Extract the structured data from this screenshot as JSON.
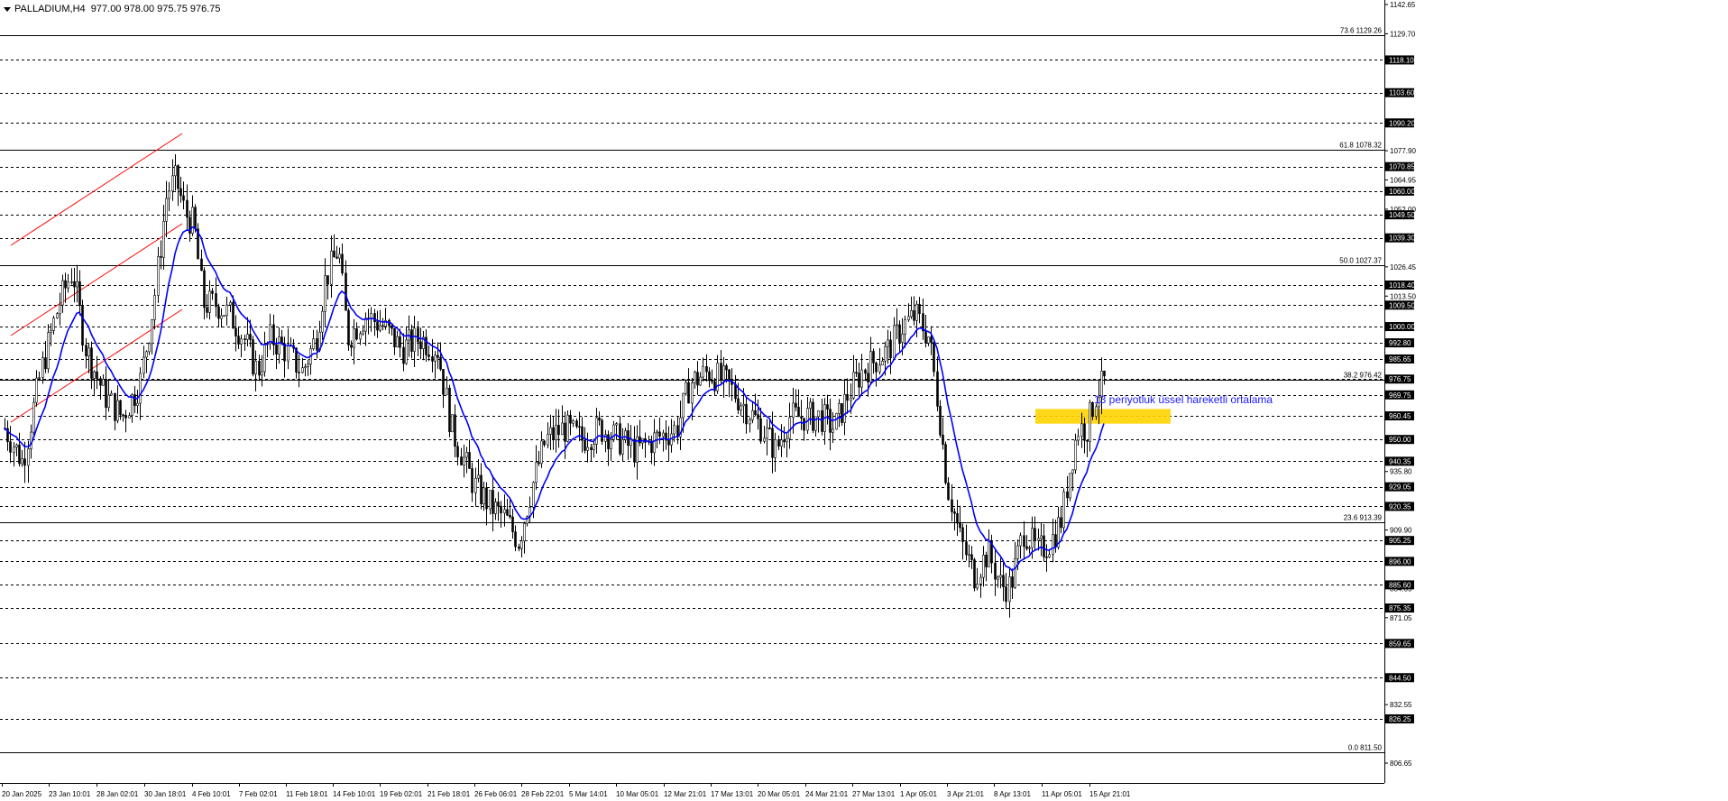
{
  "header": {
    "symbol": "PALLADIUM,H4",
    "ohlc": "977.00 978.00 975.75 976.75"
  },
  "annotation": {
    "text": "13 periyotluk üssel hareketli ortalama",
    "color": "#1a1aff"
  },
  "colors": {
    "ema": "#0000ff",
    "candle": "#000000",
    "channel": "#ff0000",
    "zone": "#ffd400",
    "fibo": "#000000"
  },
  "icons": [
    "dropdown-triangle-icon"
  ],
  "chart_data": {
    "type": "candlestick",
    "title": "PALLADIUM,H4",
    "ylim": [
      806.65,
      1142.65
    ],
    "price_axis_ticks": [
      1142.65,
      1129.7,
      1077.9,
      1064.95,
      1052.0,
      1026.45,
      1013.5,
      935.8,
      909.9,
      884.05,
      871.05,
      832.55,
      806.65
    ],
    "x_labels": [
      "20 Jan 2025",
      "23 Jan 10:01",
      "28 Jan 02:01",
      "30 Jan 18:01",
      "4 Feb 10:01",
      "7 Feb 02:01",
      "11 Feb 18:01",
      "14 Feb 10:01",
      "19 Feb 02:01",
      "21 Feb 18:01",
      "26 Feb 06:01",
      "28 Feb 22:01",
      "5 Mar 14:01",
      "10 Mar 05:01",
      "12 Mar 21:01",
      "17 Mar 13:01",
      "20 Mar 05:01",
      "24 Mar 21:01",
      "27 Mar 13:01",
      "1 Apr 05:01",
      "3 Apr 21:01",
      "8 Apr 13:01",
      "11 Apr 05:01",
      "15 Apr 21:01"
    ],
    "current_price": 976.75,
    "horizontal_levels": [
      1118.1,
      1103.6,
      1090.2,
      1070.85,
      1060.0,
      1049.5,
      1039.3,
      1018.4,
      1009.5,
      1000.0,
      992.8,
      985.65,
      976.75,
      969.75,
      960.45,
      950.0,
      940.35,
      929.05,
      920.35,
      905.25,
      896.0,
      885.6,
      875.35,
      859.65,
      844.5,
      826.25
    ],
    "fibonacci": [
      {
        "label": "73.6 1129.26",
        "value": 1129.26
      },
      {
        "label": "61.8 1078.32",
        "value": 1078.32
      },
      {
        "label": "50.0 1027.37",
        "value": 1027.37
      },
      {
        "label": "38.2 976.42",
        "value": 976.42
      },
      {
        "label": "23.6 913.39",
        "value": 913.39
      },
      {
        "label": "0.0 811.50",
        "value": 811.5
      }
    ],
    "price_path": [
      [
        0,
        955
      ],
      [
        20,
        940
      ],
      [
        40,
        980
      ],
      [
        60,
        1010
      ],
      [
        75,
        1025
      ],
      [
        90,
        990
      ],
      [
        110,
        970
      ],
      [
        130,
        960
      ],
      [
        150,
        975
      ],
      [
        165,
        1010
      ],
      [
        180,
        1060
      ],
      [
        190,
        1065
      ],
      [
        200,
        1050
      ],
      [
        210,
        1045
      ],
      [
        220,
        1010
      ],
      [
        235,
        1010
      ],
      [
        250,
        1005
      ],
      [
        265,
        995
      ],
      [
        280,
        980
      ],
      [
        295,
        995
      ],
      [
        310,
        990
      ],
      [
        330,
        980
      ],
      [
        345,
        995
      ],
      [
        355,
        1020
      ],
      [
        370,
        1035
      ],
      [
        380,
        995
      ],
      [
        400,
        1005
      ],
      [
        420,
        1000
      ],
      [
        440,
        990
      ],
      [
        460,
        995
      ],
      [
        480,
        990
      ],
      [
        495,
        955
      ],
      [
        505,
        945
      ],
      [
        520,
        930
      ],
      [
        540,
        920
      ],
      [
        555,
        915
      ],
      [
        570,
        905
      ],
      [
        585,
        930
      ],
      [
        600,
        950
      ],
      [
        620,
        955
      ],
      [
        640,
        950
      ],
      [
        660,
        955
      ],
      [
        680,
        950
      ],
      [
        700,
        945
      ],
      [
        720,
        950
      ],
      [
        745,
        955
      ],
      [
        760,
        975
      ],
      [
        780,
        980
      ],
      [
        800,
        975
      ],
      [
        820,
        965
      ],
      [
        840,
        955
      ],
      [
        855,
        945
      ],
      [
        870,
        960
      ],
      [
        890,
        960
      ],
      [
        905,
        960
      ],
      [
        920,
        955
      ],
      [
        935,
        970
      ],
      [
        950,
        980
      ],
      [
        965,
        985
      ],
      [
        980,
        990
      ],
      [
        995,
        1000
      ],
      [
        1010,
        1005
      ],
      [
        1025,
        995
      ],
      [
        1035,
        965
      ],
      [
        1045,
        930
      ],
      [
        1060,
        905
      ],
      [
        1075,
        890
      ],
      [
        1090,
        900
      ],
      [
        1105,
        885
      ],
      [
        1115,
        885
      ],
      [
        1130,
        910
      ],
      [
        1145,
        900
      ],
      [
        1160,
        905
      ],
      [
        1172,
        915
      ],
      [
        1180,
        935
      ],
      [
        1190,
        955
      ],
      [
        1200,
        955
      ],
      [
        1210,
        970
      ],
      [
        1222,
        977
      ]
    ],
    "candles_from": "price_path",
    "ema": {
      "name": "13 periyotluk üssel hareketli ortalama",
      "period": 13
    }
  }
}
